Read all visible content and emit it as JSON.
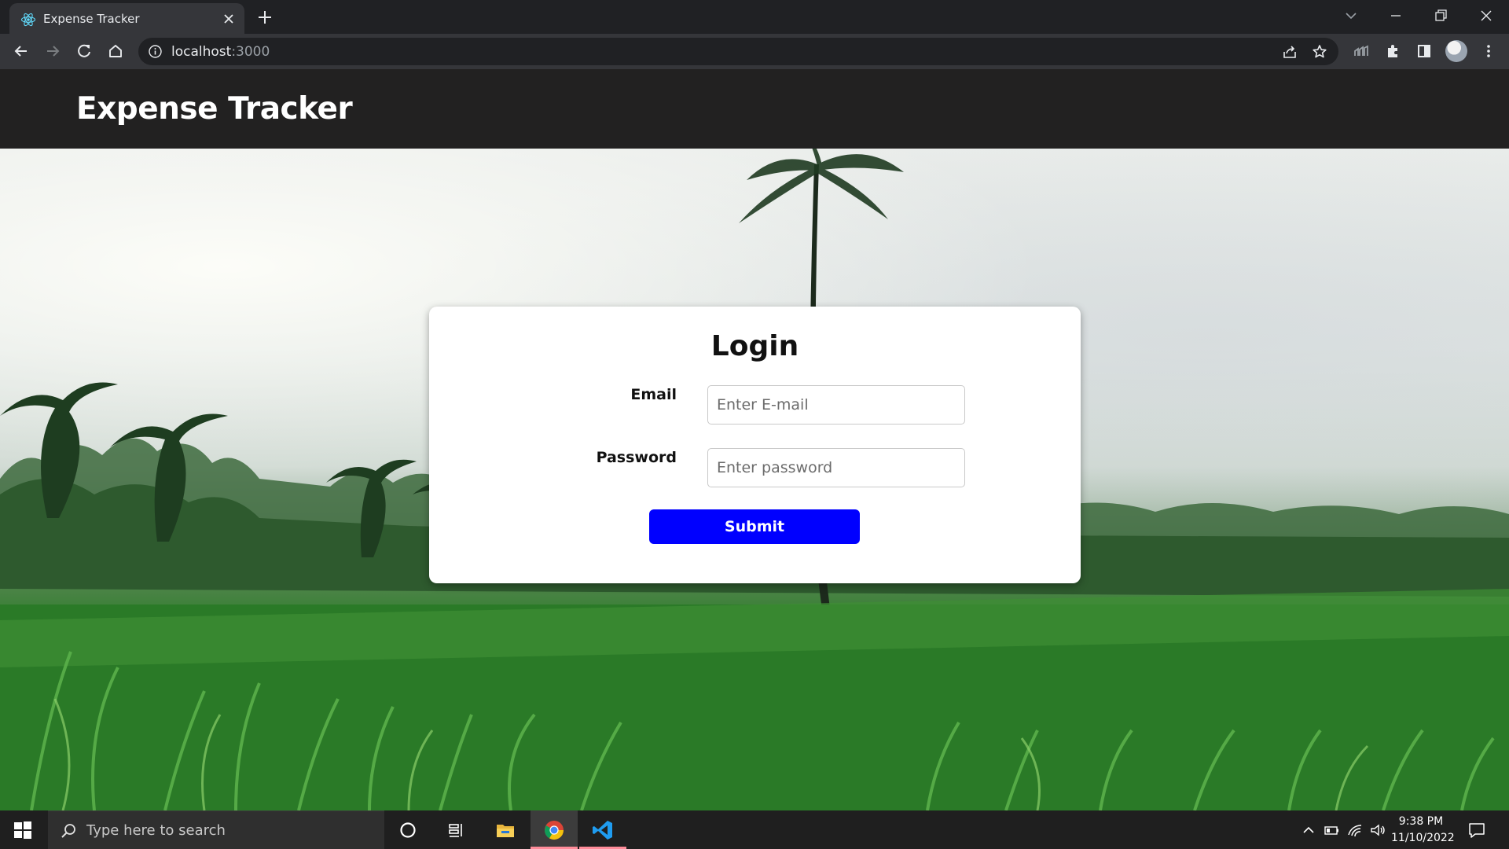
{
  "browser": {
    "tab": {
      "title": "Expense Tracker",
      "favicon": "react-logo-icon"
    },
    "address": {
      "host": "localhost",
      "port": ":3000"
    }
  },
  "app": {
    "brand": "Expense Tracker",
    "login": {
      "title": "Login",
      "email_label": "Email",
      "email_placeholder": "Enter E-mail",
      "email_value": "",
      "password_label": "Password",
      "password_placeholder": "Enter password",
      "password_value": "",
      "submit_label": "Submit"
    }
  },
  "taskbar": {
    "search_placeholder": "Type here to search",
    "time": "9:38 PM",
    "date": "11/10/2022",
    "apps": [
      "cortana-circle-icon",
      "task-view-icon",
      "file-explorer-icon",
      "chrome-icon",
      "vscode-icon"
    ]
  },
  "colors": {
    "navbar": "#222121",
    "submit": "#0000ff",
    "chrome_dark": "#202124",
    "chrome_toolbar": "#35363a"
  }
}
